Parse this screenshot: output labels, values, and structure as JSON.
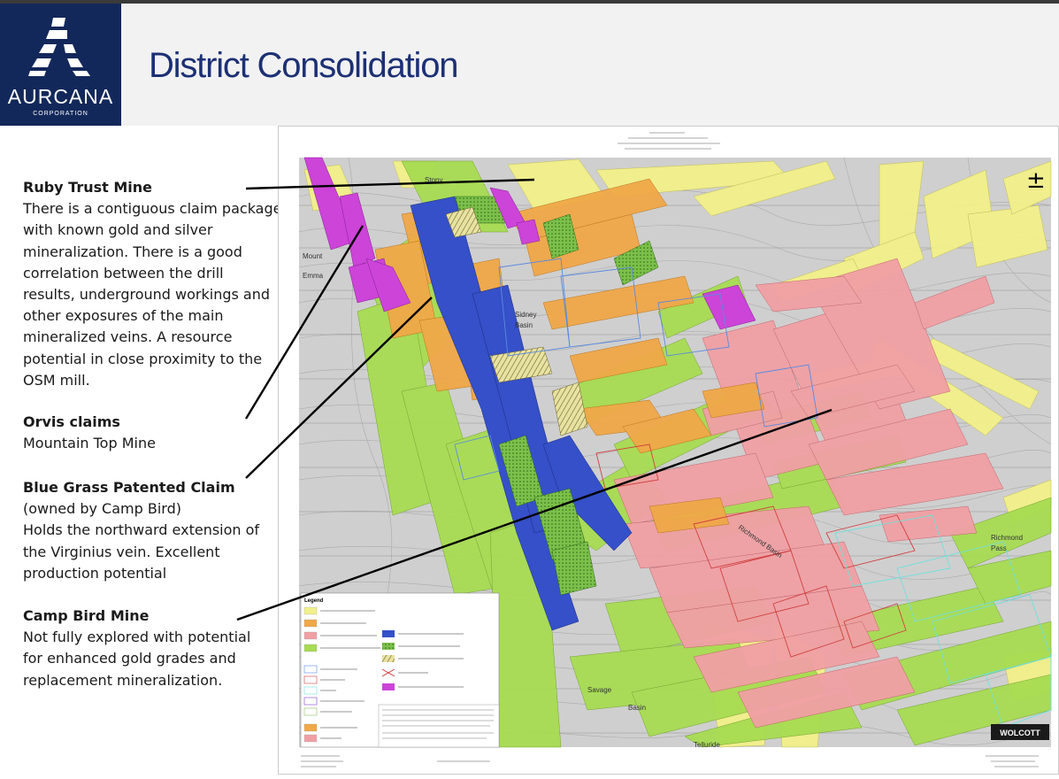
{
  "header": {
    "title": "District Consolidation",
    "logo_name": "AURCANA",
    "logo_sub": "CORPORATION"
  },
  "sections": {
    "ruby": {
      "heading": "Ruby Trust Mine",
      "lines": [
        "There is a contiguous claim package",
        "with known gold and silver",
        "mineralization. There is a good",
        "correlation between the drill",
        "results, underground workings and",
        "other exposures of the main",
        "mineralized veins. A resource",
        "potential in close proximity to the",
        "OSM mill."
      ]
    },
    "orvis": {
      "heading": "Orvis claims",
      "lines": [
        "Mountain Top Mine"
      ]
    },
    "bluegrass": {
      "heading": "Blue Grass Patented Claim",
      "lines": [
        "(owned by Camp Bird)",
        "Holds the northward extension of",
        "the Virginius vein. Excellent",
        "production potential"
      ]
    },
    "campbird": {
      "heading": "Camp Bird Mine",
      "lines": [
        "Not fully explored with potential",
        "for enhanced gold grades and",
        "replacement mineralization."
      ]
    }
  },
  "map": {
    "north_symbol": "±",
    "labels": {
      "stony": "Stony",
      "mount": "Mount",
      "emma": "Emma",
      "sidney": "Sidney",
      "basin": "Basin",
      "richmond_basin": "Richmond Basin",
      "richmond_pass": "Richmond",
      "pass": "Pass",
      "savage": "Savage",
      "savage_basin": "Basin",
      "telluride": "Telluride",
      "legend": "Legend",
      "brand": "WOLCOTT"
    },
    "colors": {
      "yellow": "#f2f08a",
      "green": "#a7dc52",
      "orange": "#f0a848",
      "pink": "#f0a0a4",
      "blue": "#3550c8",
      "magenta": "#cc44d8",
      "cyan": "#6fe0dc"
    }
  }
}
